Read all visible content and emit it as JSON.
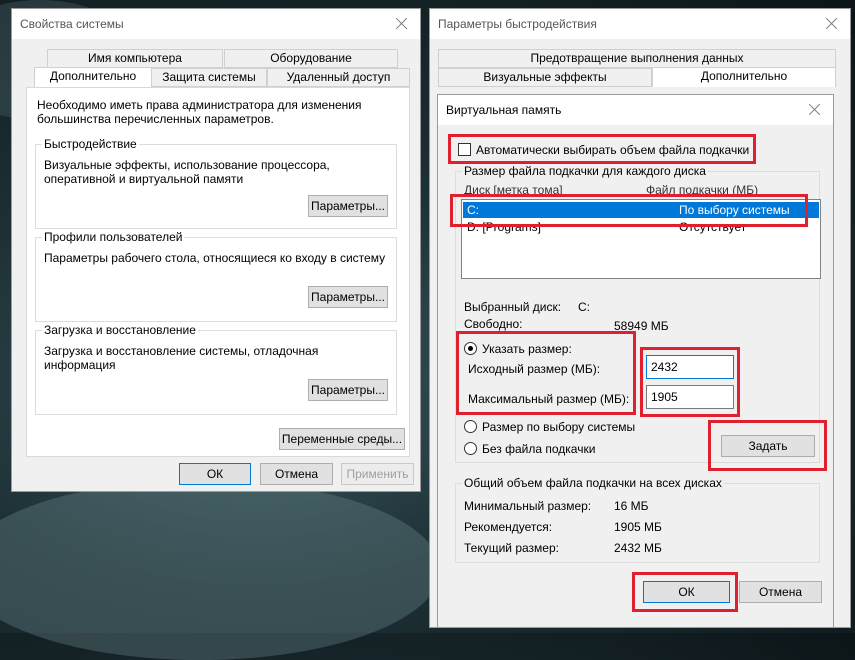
{
  "left_window": {
    "title": "Свойства системы",
    "tabs_row1": [
      "Имя компьютера",
      "Оборудование"
    ],
    "tabs_row2": [
      "Дополнительно",
      "Защита системы",
      "Удаленный доступ"
    ],
    "intro": "Необходимо иметь права администратора для изменения большинства перечисленных параметров.",
    "groups": [
      {
        "label": "Быстродействие",
        "text": "Визуальные эффекты, использование процессора, оперативной и виртуальной памяти",
        "button": "Параметры..."
      },
      {
        "label": "Профили пользователей",
        "text": "Параметры рабочего стола, относящиеся ко входу в систему",
        "button": "Параметры..."
      },
      {
        "label": "Загрузка и восстановление",
        "text": "Загрузка и восстановление системы, отладочная информация",
        "button": "Параметры..."
      }
    ],
    "env_button": "Переменные среды...",
    "ok": "ОК",
    "cancel": "Отмена",
    "apply": "Применить"
  },
  "right_window": {
    "title": "Параметры быстродействия",
    "tabs_row1": [
      "Предотвращение выполнения данных"
    ],
    "tabs_row2": [
      "Визуальные эффекты",
      "Дополнительно"
    ]
  },
  "vm_dialog": {
    "title": "Виртуальная память",
    "auto_checkbox": "Автоматически выбирать объем файла подкачки",
    "auto_checked": false,
    "section_label": "Размер файла подкачки для каждого диска",
    "col_disk": "Диск [метка тома]",
    "col_file": "Файл подкачки (МБ)",
    "rows": [
      {
        "disk": "C:",
        "file": "По выбору системы"
      },
      {
        "disk": "D:      [Programs]",
        "file": "Отсутствует"
      }
    ],
    "selected_disk_label": "Выбранный диск:",
    "selected_disk_value": "C:",
    "free_label": "Свободно:",
    "free_value": "58949 МБ",
    "custom_size_label": "Указать размер:",
    "initial_label": "Исходный размер (МБ):",
    "initial_value": "2432",
    "max_label": "Максимальный размер (МБ):",
    "max_value": "1905",
    "system_size_label": "Размер по выбору системы",
    "no_file_label": "Без файла подкачки",
    "set_button": "Задать",
    "total_section": "Общий объем файла подкачки на всех дисках",
    "min_label": "Минимальный размер:",
    "min_value": "16 МБ",
    "rec_label": "Рекомендуется:",
    "rec_value": "1905 МБ",
    "cur_label": "Текущий размер:",
    "cur_value": "2432 МБ",
    "ok": "ОК",
    "cancel": "Отмена"
  },
  "colors": {
    "highlight": "#e0202e",
    "selection": "#0078d7"
  }
}
